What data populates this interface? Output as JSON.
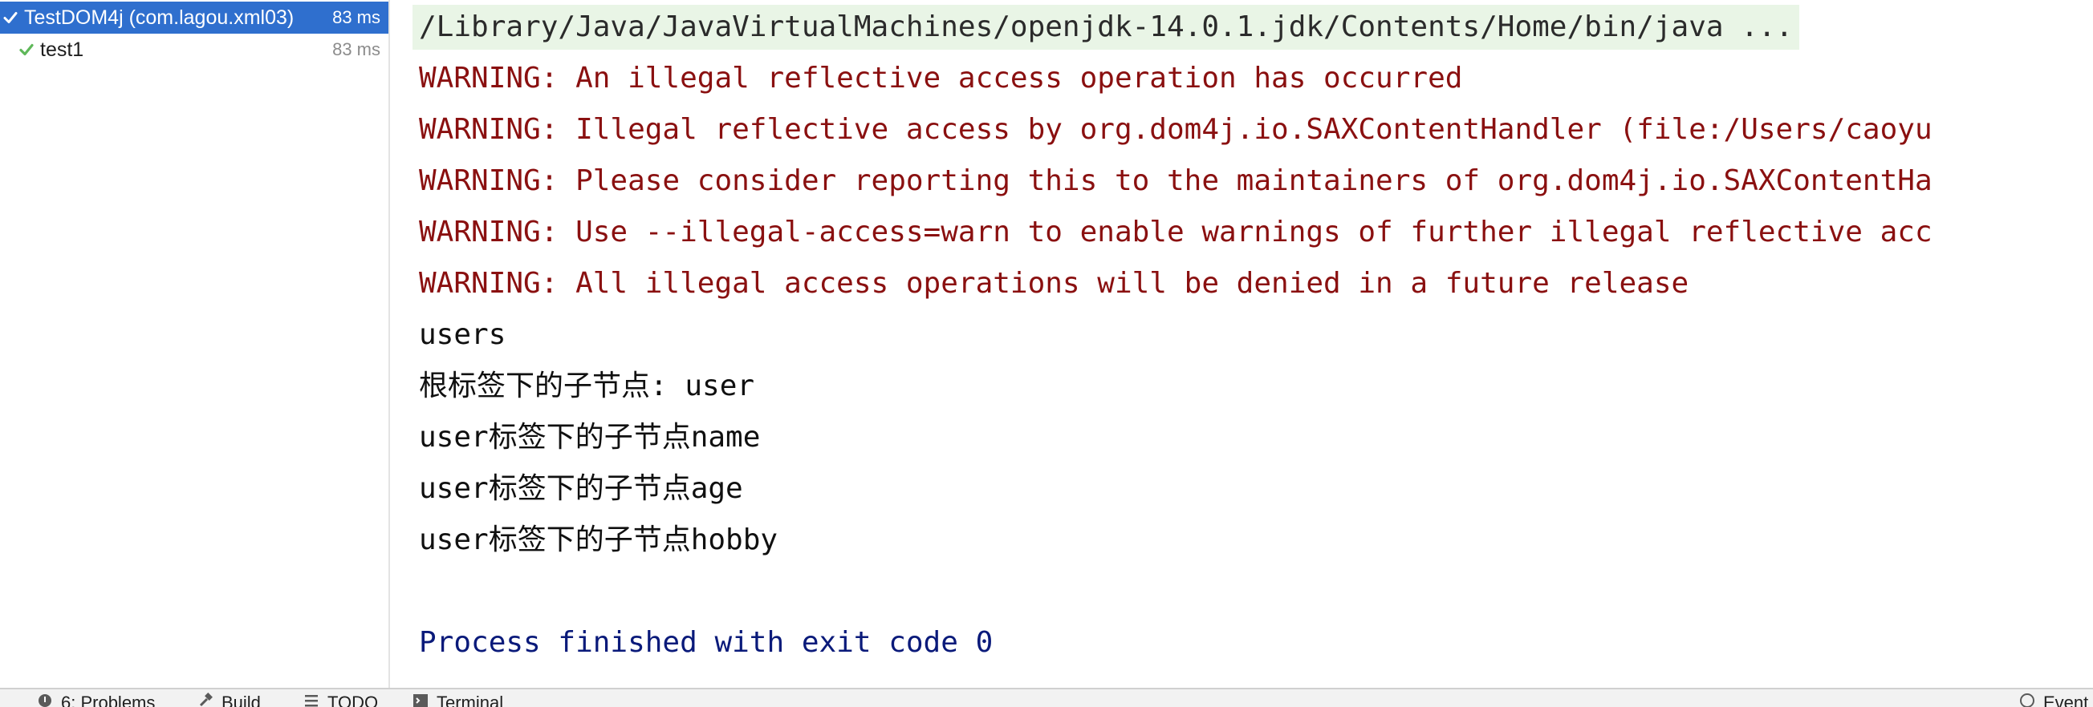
{
  "test_tree": {
    "root": {
      "label": "TestDOM4j (com.lagou.xml03)",
      "time": "83 ms",
      "status": "passed"
    },
    "children": [
      {
        "label": "test1",
        "time": "83 ms",
        "status": "passed"
      }
    ]
  },
  "console": {
    "command": "/Library/Java/JavaVirtualMachines/openjdk-14.0.1.jdk/Contents/Home/bin/java ...",
    "warnings": [
      "WARNING: An illegal reflective access operation has occurred",
      "WARNING: Illegal reflective access by org.dom4j.io.SAXContentHandler (file:/Users/caoyu",
      "WARNING: Please consider reporting this to the maintainers of org.dom4j.io.SAXContentHa",
      "WARNING: Use --illegal-access=warn to enable warnings of further illegal reflective acc",
      "WARNING: All illegal access operations will be denied in a future release"
    ],
    "output": [
      "users",
      "根标签下的子节点: user",
      "user标签下的子节点name",
      "user标签下的子节点age",
      "user标签下的子节点hobby"
    ],
    "exit_message": "Process finished with exit code 0"
  },
  "bottom_bar": {
    "problems": "6: Problems",
    "build": "Build",
    "todo": "TODO",
    "terminal": "Terminal",
    "event_log": "Event"
  },
  "colors": {
    "selection": "#2f6fce",
    "pass_check": "#5fb85a",
    "warning_text": "#8a1010",
    "exit_text": "#0a1a7a",
    "command_bg": "#e9f5e6"
  }
}
